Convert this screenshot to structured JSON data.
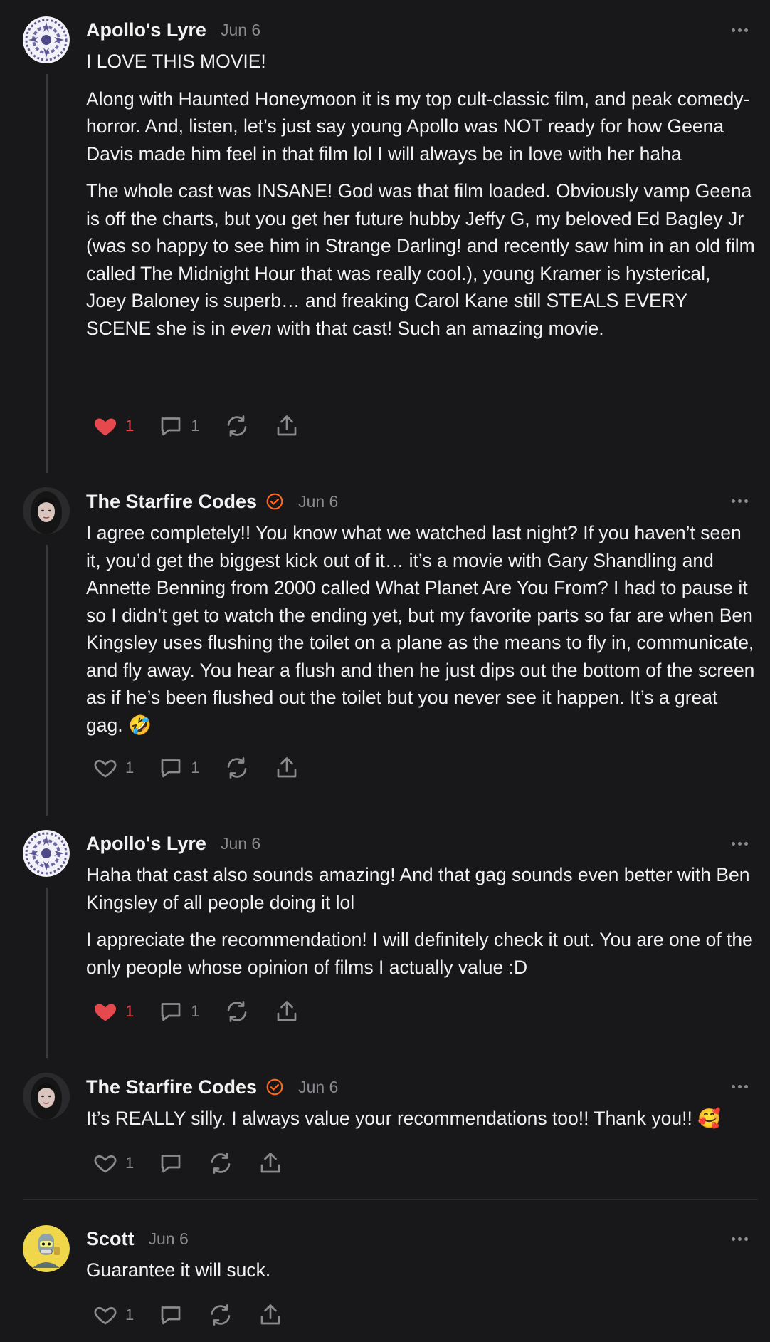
{
  "posts": [
    {
      "author": "Apollo's Lyre",
      "date": "Jun 6",
      "verified": false,
      "paragraphs": [
        "I LOVE THIS MOVIE!",
        "Along with Haunted Honeymoon it is my top cult-classic film, and peak comedy-horror. And, listen, let’s just say young Apollo was NOT ready for how Geena Davis made him feel in that film lol I will always be in love with her haha",
        "The whole cast was INSANE! God was that film loaded. Obviously vamp Geena is off the charts, but you get her future hubby Jeffy G, my beloved Ed Bagley Jr (was so happy to see him in Strange Darling! and recently saw him in an old film called The Midnight Hour that was really cool.), young Kramer is hysterical, Joey Baloney is superb… and freaking Carol Kane still STEALS EVERY SCENE she is in ",
        "even",
        " with that cast! Such an amazing movie."
      ],
      "likes": "1",
      "comments": "1",
      "liked": true
    },
    {
      "author": "The Starfire Codes",
      "date": "Jun 6",
      "verified": true,
      "paragraphs": [
        "I agree completely!! You know what we watched last night? If you haven’t seen it, you’d get the biggest kick out of it… it’s a movie with Gary Shandling and Annette Benning from 2000 called What Planet Are You From? I had to pause it so I didn’t get to watch the ending yet, but my favorite parts so far are when Ben Kingsley uses flushing the toilet on a plane as the means to fly in, communicate, and fly away. You hear a flush and then he just dips out the bottom of the screen as if he’s been flushed out the toilet but you never see it happen. It’s a great gag. 🤣"
      ],
      "likes": "1",
      "comments": "1",
      "liked": false
    },
    {
      "author": "Apollo's Lyre",
      "date": "Jun 6",
      "verified": false,
      "paragraphs": [
        "Haha that cast also sounds amazing! And that gag sounds even better with Ben Kingsley of all people doing it lol",
        "I appreciate the recommendation! I will definitely check it out. You are one of the only people whose opinion of films I actually value :D"
      ],
      "likes": "1",
      "comments": "1",
      "liked": true
    },
    {
      "author": "The Starfire Codes",
      "date": "Jun 6",
      "verified": true,
      "paragraphs": [
        "It’s REALLY silly. I always value your recommendations too!! Thank you!! 🥰"
      ],
      "likes": "1",
      "comments": "",
      "liked": false
    },
    {
      "author": "Scott",
      "date": "Jun 6",
      "verified": false,
      "paragraphs": [
        "Guarantee it will suck."
      ],
      "likes": "1",
      "comments": "",
      "liked": false
    }
  ],
  "colors": {
    "background": "#18181a",
    "text": "#f2f2f2",
    "muted": "#8a8a8f",
    "like": "#e5484d",
    "verified": "#ff6719"
  },
  "icons": [
    "heart-icon",
    "comment-icon",
    "restack-icon",
    "share-icon",
    "more-icon",
    "verified-icon"
  ]
}
